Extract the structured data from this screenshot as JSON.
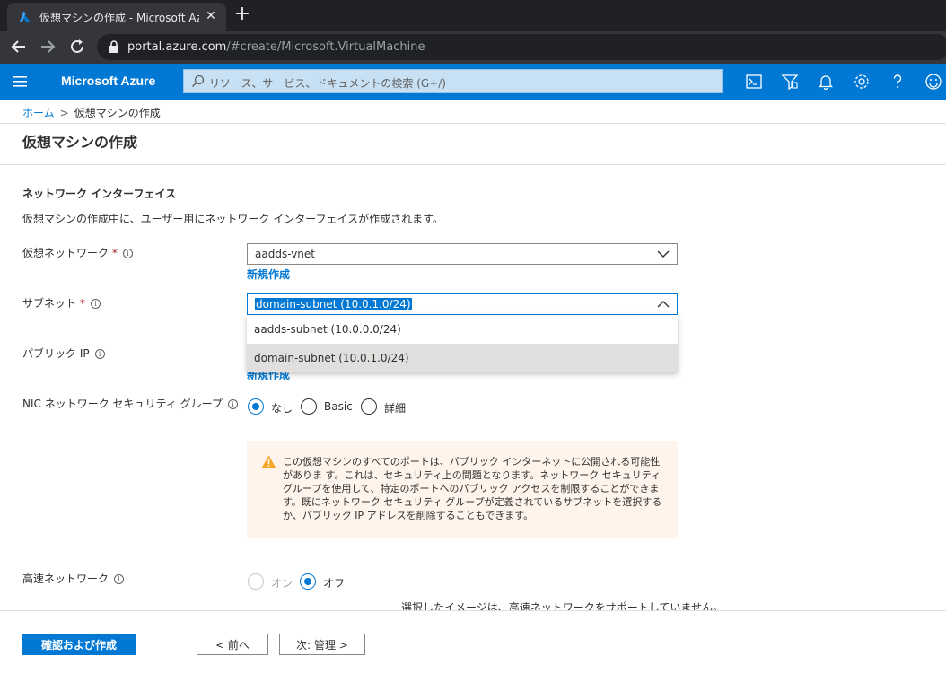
{
  "browser": {
    "tab_title": "仮想マシンの作成 - Microsoft Azure",
    "tab_close": "✕",
    "new_tab": "+",
    "url_host": "portal.azure.com",
    "url_path": "/#create/Microsoft.VirtualMachine"
  },
  "header": {
    "brand": "Microsoft Azure",
    "search_placeholder": "リソース、サービス、ドキュメントの検索 (G+/)",
    "icons": [
      "cloud-shell-icon",
      "directory-filter-icon",
      "notifications-icon",
      "settings-icon",
      "help-icon",
      "feedback-icon"
    ]
  },
  "breadcrumb": {
    "home": "ホーム",
    "separator": ">",
    "current": "仮想マシンの作成"
  },
  "page_title": "仮想マシンの作成",
  "section": {
    "title": "ネットワーク インターフェイス",
    "description": "仮想マシンの作成中に、ユーザー用にネットワーク インターフェイスが作成されます。"
  },
  "fields": {
    "vnet": {
      "label": "仮想ネットワーク",
      "required": "*",
      "value": "aadds-vnet",
      "create_new": "新規作成"
    },
    "subnet": {
      "label": "サブネット",
      "required": "*",
      "value": "domain-subnet (10.0.1.0/24)",
      "options": [
        "aadds-subnet (10.0.0.0/24)",
        "domain-subnet (10.0.1.0/24)"
      ]
    },
    "public_ip": {
      "label": "パブリック IP",
      "create_new": "新規作成"
    },
    "nsg": {
      "label": "NIC ネットワーク セキュリティ グループ",
      "options": [
        "なし",
        "Basic",
        "詳細"
      ],
      "selected": "なし"
    },
    "accelerated": {
      "label": "高速ネットワーク",
      "options": [
        "オン",
        "オフ"
      ],
      "selected": "オフ",
      "note": "選択したイメージは、高速ネットワークをサポートしていません。"
    }
  },
  "warning": {
    "text": "この仮想マシンのすべてのポートは、パブリック インターネットに公開される可能性がありま す。これは、セキュリティ上の問題となります。ネットワーク セキュリティ グループを使用して、特定のポートへのパブリック アクセスを制限することができます。既にネットワーク セキュリティ グループが定義されているサブネットを選択するか、パブリック IP アドレスを削除することもできます。",
    "color": "#d83b01"
  },
  "footer": {
    "review_create": "確認および作成",
    "previous": "< 前へ",
    "next": "次: 管理 >"
  },
  "colors": {
    "accent": "#0078d4",
    "browser_dark": "#202124"
  }
}
